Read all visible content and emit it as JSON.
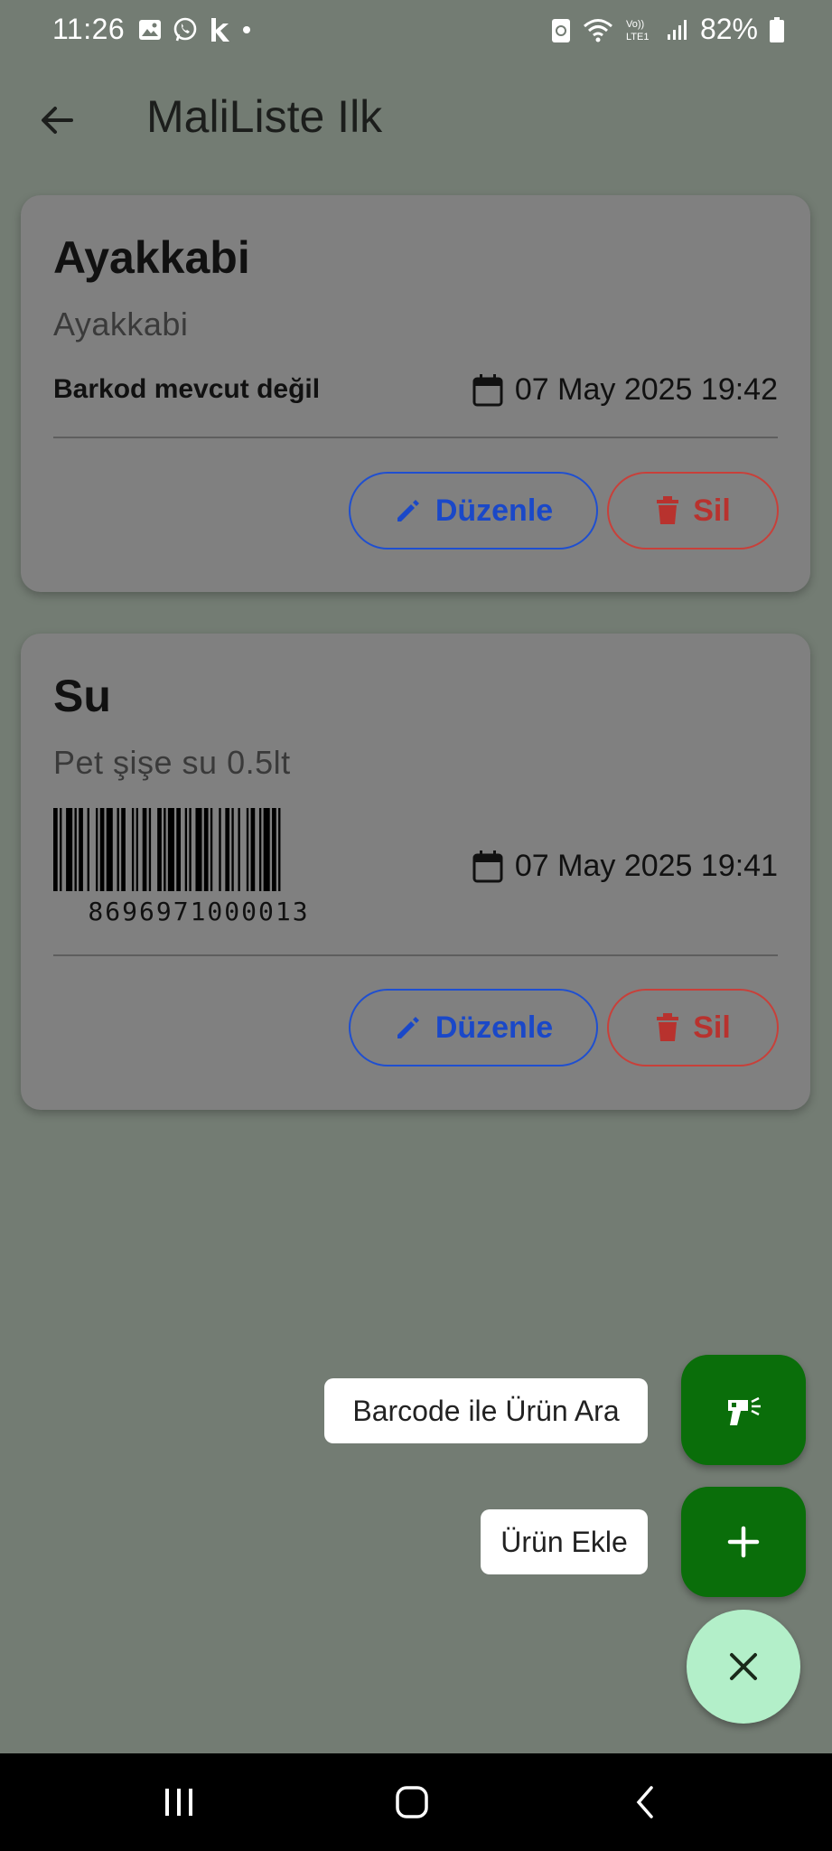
{
  "status_bar": {
    "time": "11:26",
    "battery_percent": "82%",
    "left_icons": [
      "gallery-icon",
      "whatsapp-icon",
      "k-app-icon",
      "dot-icon"
    ],
    "right_icons": [
      "sync-icon",
      "wifi-icon",
      "volte-icon",
      "signal-icon",
      "battery-icon"
    ]
  },
  "app_bar": {
    "title": "MaliListe Ilk",
    "back_icon": "arrow-left-icon"
  },
  "products": [
    {
      "title": "Ayakkabi",
      "description": "Ayakkabi",
      "barcode_text": "Barkod mevcut değil",
      "date": "07 May 2025 19:42",
      "edit_label": "Düzenle",
      "delete_label": "Sil"
    },
    {
      "title": "Su",
      "description": "Pet şişe su 0.5lt",
      "barcode_number": "8696971000013",
      "date": "07 May 2025 19:41",
      "edit_label": "Düzenle",
      "delete_label": "Sil"
    }
  ],
  "fab_menu": {
    "barcode_search_label": "Barcode ile Ürün Ara",
    "add_product_label": "Ürün Ekle",
    "close_icon": "close-icon"
  },
  "colors": {
    "background": "#737c73",
    "card": "#808080",
    "edit_accent": "#1a48c8",
    "delete_accent": "#b8322e",
    "fab_green": "#0a6e0a",
    "fab_close_bg": "#b3efc9"
  }
}
